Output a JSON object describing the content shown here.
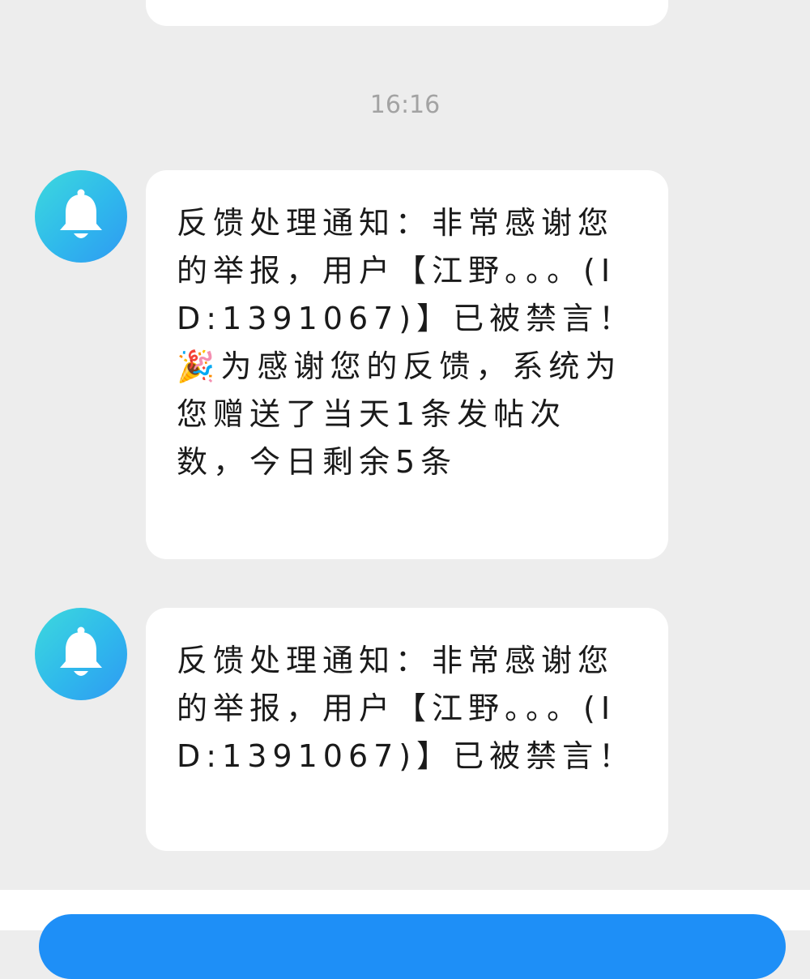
{
  "timestamp": "16:16",
  "messages": [
    {
      "avatar_icon": "bell-icon",
      "text": "反馈处理通知：非常感谢您的举报，用户【江野。。。(ID:1391067)】已被禁言！\n🎉为感谢您的反馈，系统为您赠送了当天1条发帖次数，今日剩余5条"
    },
    {
      "avatar_icon": "bell-icon",
      "text": "反馈处理通知：非常感谢您的举报，用户【江野。。。(ID:1391067)】已被禁言！"
    }
  ],
  "colors": {
    "background": "#ededed",
    "bubble": "#ffffff",
    "timestamp": "#a3a3a3",
    "avatar_gradient_start": "#3dd9dd",
    "avatar_gradient_end": "#2f9af2",
    "button": "#1e8ff7"
  }
}
